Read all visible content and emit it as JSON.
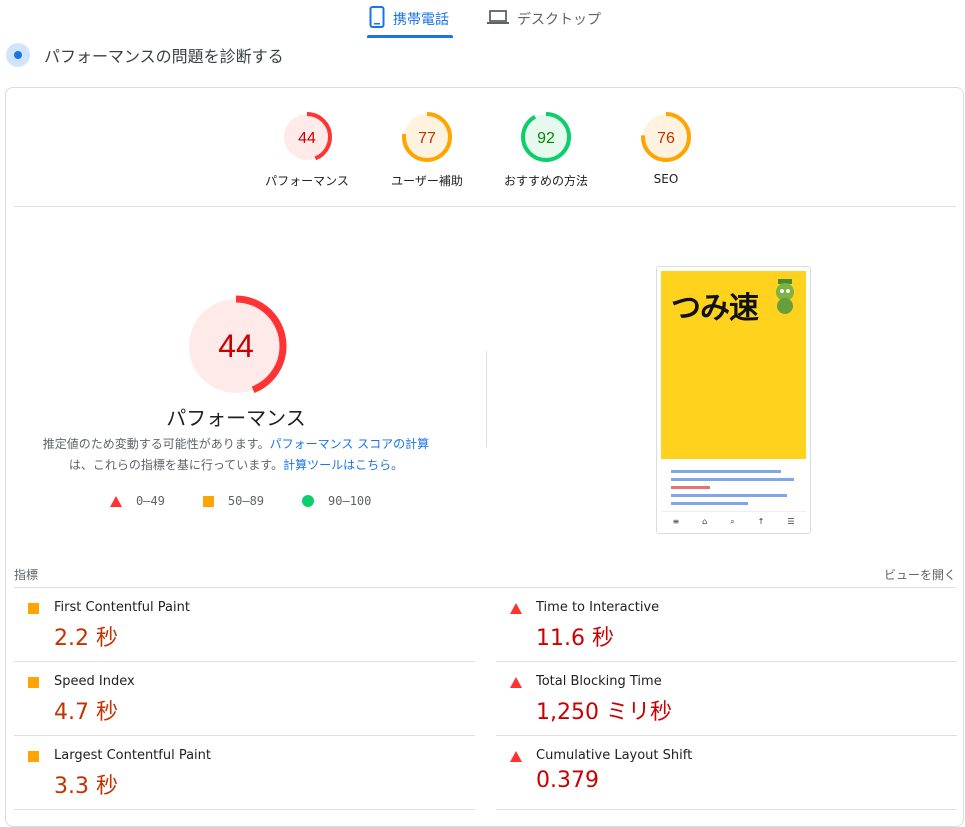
{
  "tabs": [
    {
      "label": "携帯電話",
      "icon": "smartphone-icon",
      "active": true
    },
    {
      "label": "デスクトップ",
      "icon": "laptop-icon",
      "active": false
    }
  ],
  "title": "パフォーマンスの問題を診断する",
  "categories": [
    {
      "score": "44",
      "label": "パフォーマンス",
      "status": "fail",
      "fraction": 0.44
    },
    {
      "score": "77",
      "label": "ユーザー補助",
      "status": "average",
      "fraction": 0.77
    },
    {
      "score": "92",
      "label": "おすすめの方法",
      "status": "pass",
      "fraction": 0.92
    },
    {
      "score": "76",
      "label": "SEO",
      "status": "average",
      "fraction": 0.76
    }
  ],
  "main_score": {
    "score": "44",
    "fraction": 0.44,
    "title": "パフォーマンス",
    "desc_part1": "推定値のため変動する可能性があります。",
    "desc_link1": "パフォーマンス スコアの計算",
    "desc_part2": "は、これらの指標を基に行っています。",
    "desc_link2": "計算ツールはこちら。"
  },
  "legend": [
    {
      "label": "0–49",
      "shape": "triangle"
    },
    {
      "label": "50–89",
      "shape": "square"
    },
    {
      "label": "90–100",
      "shape": "circle"
    }
  ],
  "screenshot": {
    "logo_text": "つみ速",
    "nav": [
      "≡",
      "⌂",
      "⌕",
      "↑",
      "☰"
    ]
  },
  "metrics_header": {
    "label": "指標",
    "view_link": "ビューを開く"
  },
  "metrics": [
    {
      "name": "First Contentful Paint",
      "value": "2.2 秒",
      "status": "average"
    },
    {
      "name": "Time to Interactive",
      "value": "11.6 秒",
      "status": "fail"
    },
    {
      "name": "Speed Index",
      "value": "4.7 秒",
      "status": "average"
    },
    {
      "name": "Total Blocking Time",
      "value": "1,250 ミリ秒",
      "status": "fail"
    },
    {
      "name": "Largest Contentful Paint",
      "value": "3.3 秒",
      "status": "average"
    },
    {
      "name": "Cumulative Layout Shift",
      "value": "0.379",
      "status": "fail"
    }
  ],
  "colors": {
    "fail": "#ff3333",
    "fail_text": "#cc0000",
    "fail_bg": "#ffeaea",
    "average": "#ffa400",
    "average_text": "#c33300",
    "average_bg": "#fff3e0",
    "pass": "#0cce6b",
    "pass_text": "#008800",
    "pass_bg": "#e6f9ee",
    "accent": "#1a73e8"
  }
}
